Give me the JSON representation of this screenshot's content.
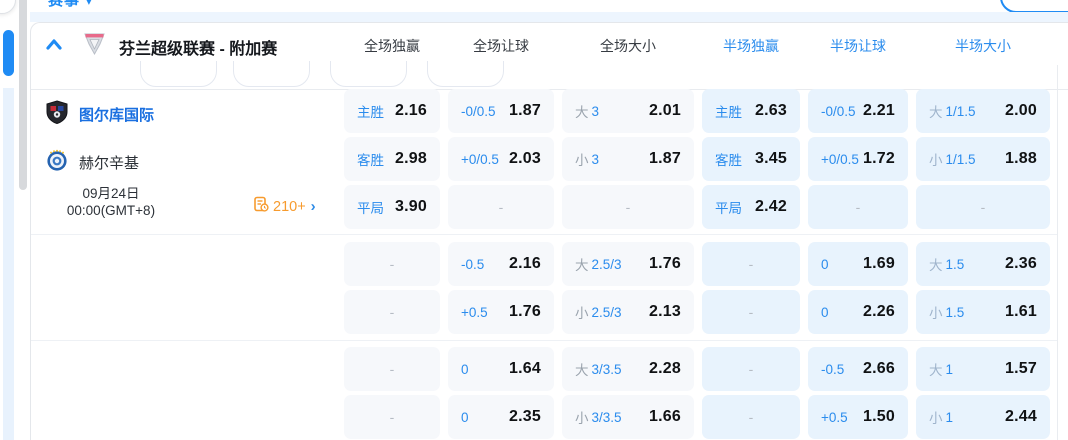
{
  "top_bar": {
    "clipped_label": "赛事 ▾"
  },
  "league": {
    "title": "芬兰超级联赛 - 附加赛",
    "collapse_icon": "chevron-up",
    "badge_icon": "league-shield",
    "pin_icon": "pin",
    "columns": [
      {
        "label": "全场独赢",
        "half": false
      },
      {
        "label": "全场让球",
        "half": false
      },
      {
        "label": "全场大小",
        "half": false
      },
      {
        "label": "半场独赢",
        "half": true
      },
      {
        "label": "半场让球",
        "half": true
      },
      {
        "label": "半场大小",
        "half": true
      }
    ]
  },
  "match": {
    "home_team": "图尔库国际",
    "away_team": "赫尔辛基",
    "date": "09月24日",
    "time": "00:00(GMT+8)",
    "more_markets": "210+",
    "more_markets_icon": "markets-doc-clock",
    "more_markets_chevron": "›"
  },
  "odds_groups": [
    {
      "rows": [
        {
          "cells": [
            {
              "label": "主胜",
              "value": "2.16"
            },
            {
              "label": "-0/0.5",
              "value": "1.87"
            },
            {
              "prefix": "大",
              "label": "3",
              "value": "2.01"
            },
            {
              "label": "主胜",
              "value": "2.63"
            },
            {
              "label": "-0/0.5",
              "value": "2.21"
            },
            {
              "prefix": "大",
              "label": "1/1.5",
              "value": "2.00"
            }
          ]
        },
        {
          "cells": [
            {
              "label": "客胜",
              "value": "2.98"
            },
            {
              "label": "+0/0.5",
              "value": "2.03"
            },
            {
              "prefix": "小",
              "label": "3",
              "value": "1.87"
            },
            {
              "label": "客胜",
              "value": "3.45"
            },
            {
              "label": "+0/0.5",
              "value": "1.72"
            },
            {
              "prefix": "小",
              "label": "1/1.5",
              "value": "1.88"
            }
          ]
        },
        {
          "cells": [
            {
              "label": "平局",
              "value": "3.90"
            },
            {
              "dash": true
            },
            {
              "dash": true
            },
            {
              "label": "平局",
              "value": "2.42"
            },
            {
              "dash": true
            },
            {
              "dash": true
            }
          ]
        }
      ]
    },
    {
      "rows": [
        {
          "cells": [
            {
              "dash": true
            },
            {
              "label": "-0.5",
              "value": "2.16"
            },
            {
              "prefix": "大",
              "label": "2.5/3",
              "value": "1.76"
            },
            {
              "dash": true
            },
            {
              "label": "0",
              "value": "1.69"
            },
            {
              "prefix": "大",
              "label": "1.5",
              "value": "2.36"
            }
          ]
        },
        {
          "cells": [
            {
              "dash": true
            },
            {
              "label": "+0.5",
              "value": "1.76"
            },
            {
              "prefix": "小",
              "label": "2.5/3",
              "value": "2.13"
            },
            {
              "dash": true
            },
            {
              "label": "0",
              "value": "2.26"
            },
            {
              "prefix": "小",
              "label": "1.5",
              "value": "1.61"
            }
          ]
        }
      ]
    },
    {
      "rows": [
        {
          "cells": [
            {
              "dash": true
            },
            {
              "label": "0",
              "value": "1.64"
            },
            {
              "prefix": "大",
              "label": "3/3.5",
              "value": "2.28"
            },
            {
              "dash": true
            },
            {
              "label": "-0.5",
              "value": "2.66"
            },
            {
              "prefix": "大",
              "label": "1",
              "value": "1.57"
            }
          ]
        },
        {
          "cells": [
            {
              "dash": true
            },
            {
              "label": "0",
              "value": "2.35"
            },
            {
              "prefix": "小",
              "label": "3/3.5",
              "value": "1.66"
            },
            {
              "dash": true
            },
            {
              "label": "+0.5",
              "value": "1.50"
            },
            {
              "prefix": "小",
              "label": "1",
              "value": "2.44"
            }
          ]
        }
      ]
    }
  ],
  "colors": {
    "accent_blue": "#1f8bf4",
    "header_half_blue": "#2b8ced",
    "team_link_blue": "#1a6fe0",
    "orange": "#f79b2e",
    "cell_bg": "#f6f8fb",
    "cell_bg_half": "#e8f3fd",
    "odds_text": "#101214"
  }
}
